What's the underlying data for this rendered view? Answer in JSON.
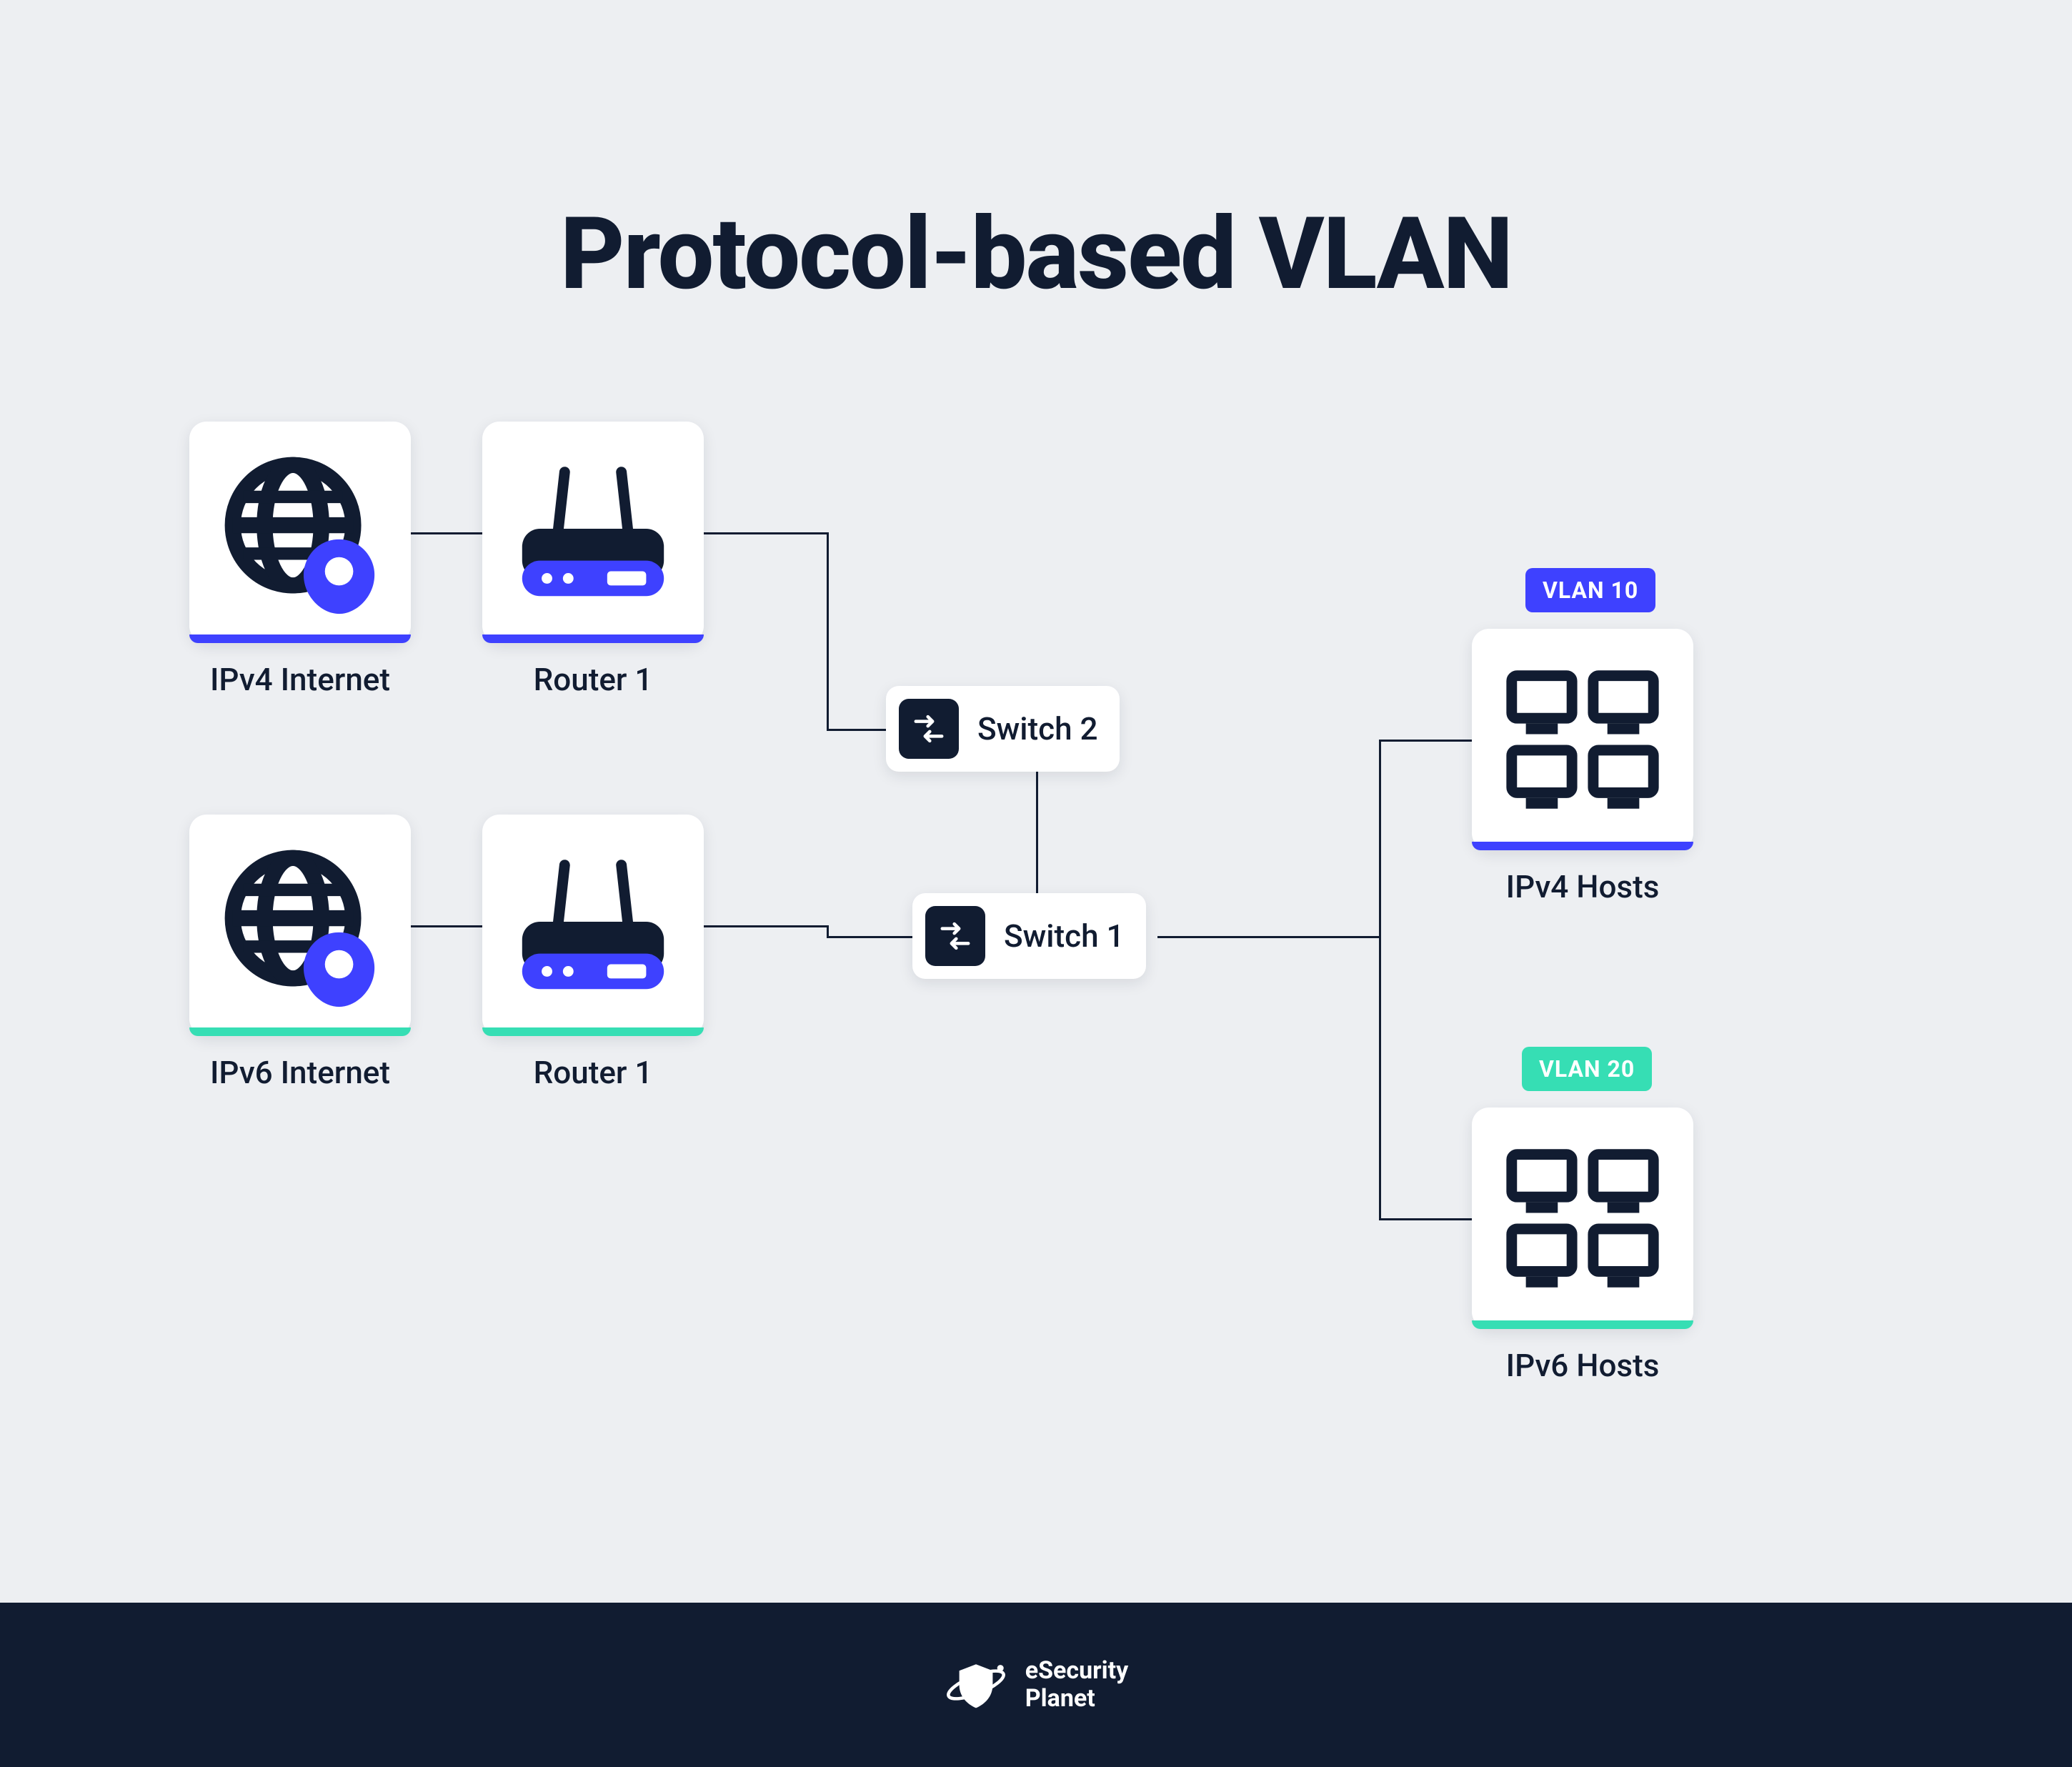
{
  "title": "Protocol-based VLAN",
  "nodes": {
    "ipv4_internet": {
      "label": "IPv4 Internet",
      "accent": "blue"
    },
    "ipv6_internet": {
      "label": "IPv6 Internet",
      "accent": "teal"
    },
    "router_top": {
      "label": "Router 1",
      "accent": "blue"
    },
    "router_bottom": {
      "label": "Router 1",
      "accent": "teal"
    },
    "switch2": {
      "label": "Switch 2"
    },
    "switch1": {
      "label": "Switch 1"
    },
    "ipv4_hosts": {
      "label": "IPv4 Hosts",
      "accent": "blue",
      "tag": "VLAN 10"
    },
    "ipv6_hosts": {
      "label": "IPv6 Hosts",
      "accent": "teal",
      "tag": "VLAN 20"
    }
  },
  "footer": {
    "brand_top": "eSecurity",
    "brand_bottom": "Planet"
  },
  "colors": {
    "navy": "#111c31",
    "blue": "#3e41ff",
    "teal": "#36deb4",
    "bg": "#edeff2"
  },
  "edges": [
    [
      "ipv4_internet",
      "router_top"
    ],
    [
      "ipv6_internet",
      "router_bottom"
    ],
    [
      "router_top",
      "switch2"
    ],
    [
      "router_bottom",
      "switch1"
    ],
    [
      "switch2",
      "switch1"
    ],
    [
      "switch1",
      "ipv4_hosts"
    ],
    [
      "switch1",
      "ipv6_hosts"
    ]
  ]
}
